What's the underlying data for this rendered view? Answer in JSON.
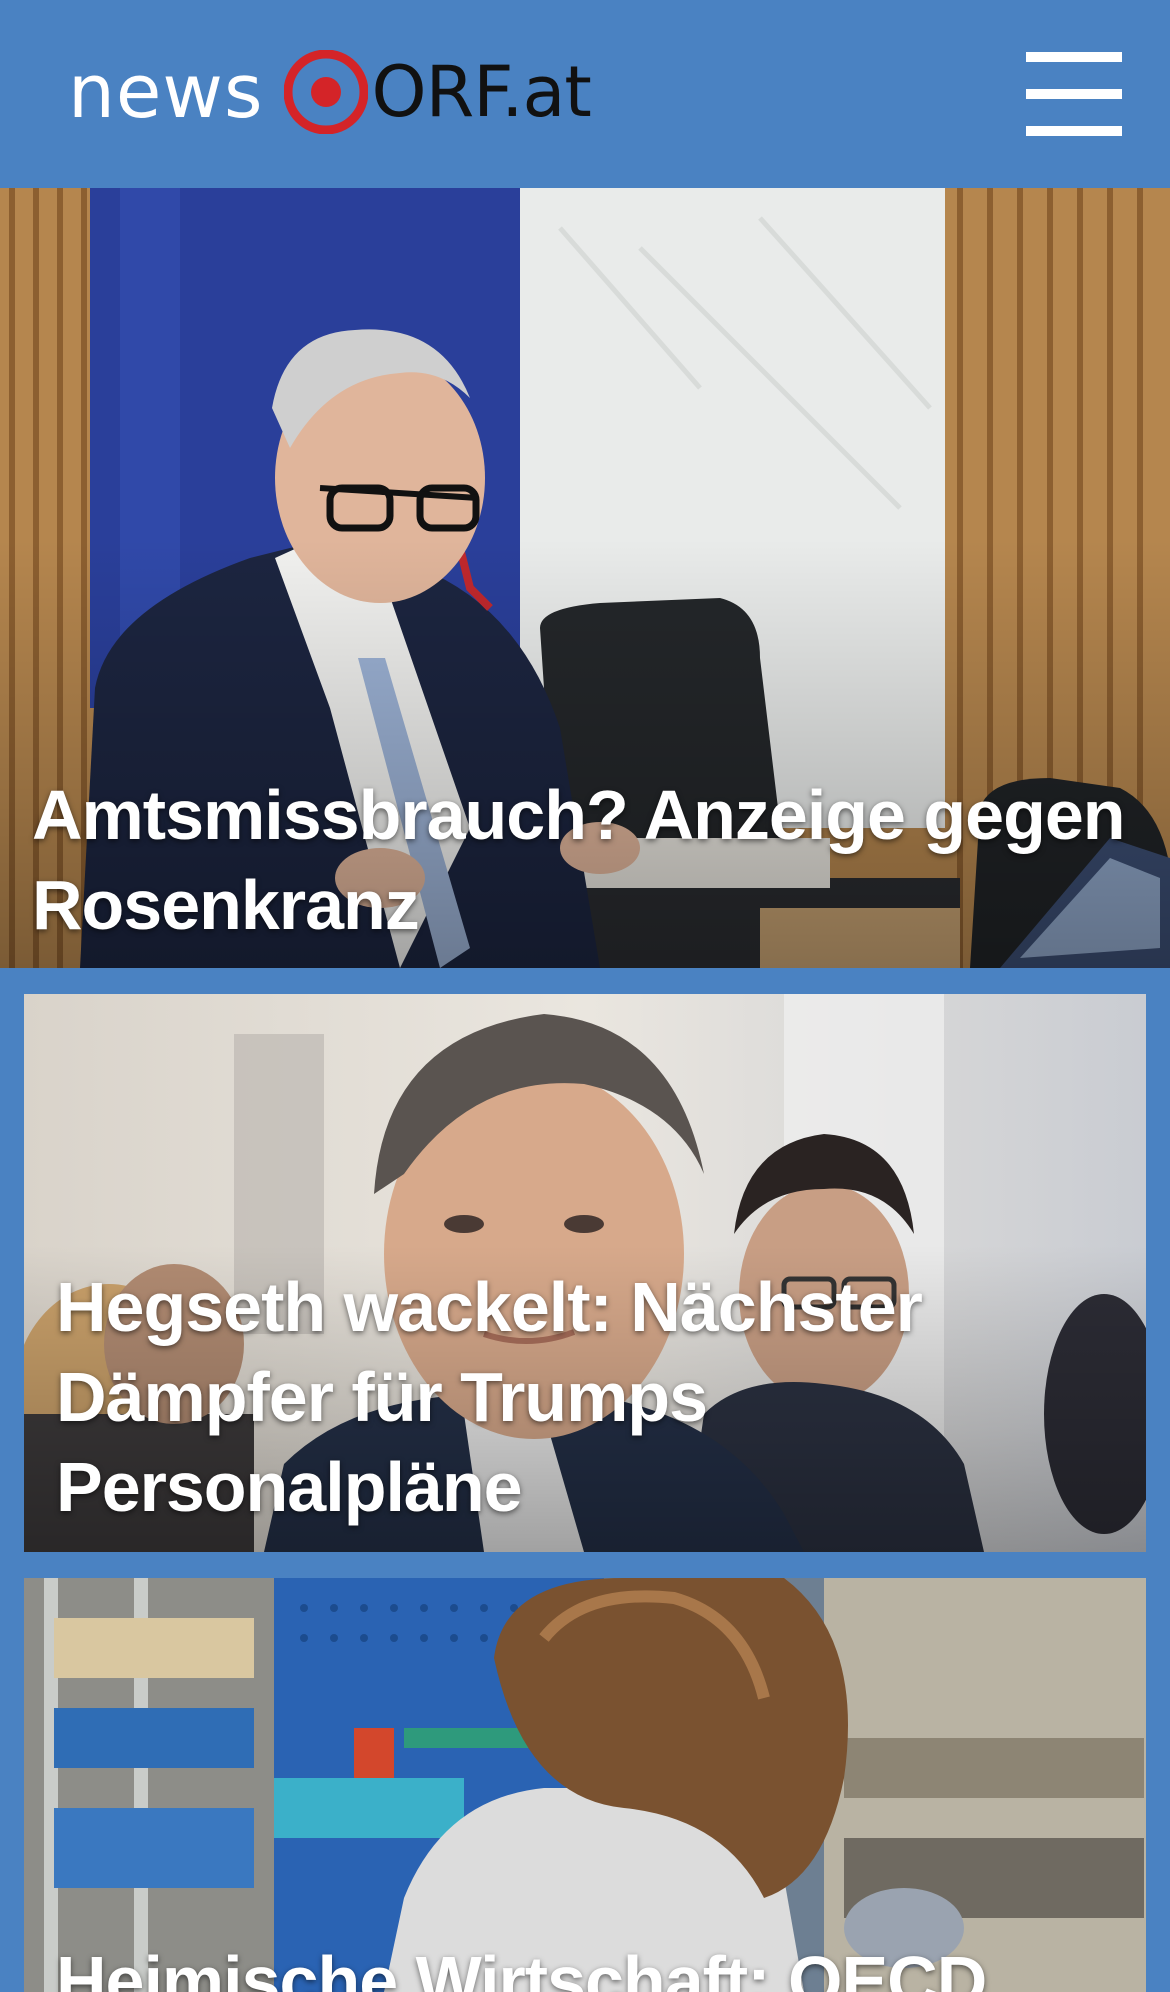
{
  "header": {
    "logo_news": "news",
    "logo_orf": "ORF.at",
    "menu_icon": "hamburger-menu-icon"
  },
  "stories": [
    {
      "headline": "Amtsmissbrauch? Anzeige gegen Rosenkranz"
    },
    {
      "headline": "Hegseth wackelt: Nächster Dämpfer für Trumps Personalpläne"
    },
    {
      "headline": "Heimische Wirtschaft: OECD"
    }
  ],
  "colors": {
    "brand_blue": "#4a82c2",
    "logo_red": "#d42428",
    "headline_text": "#ffffff"
  }
}
